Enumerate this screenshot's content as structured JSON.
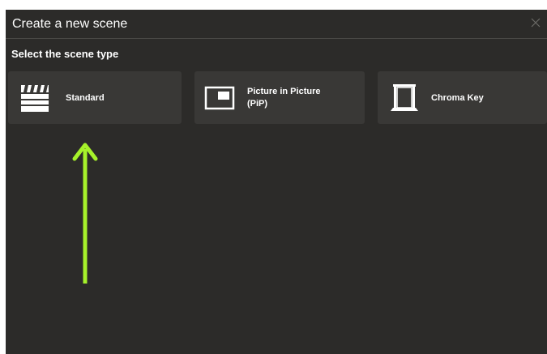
{
  "dialog": {
    "title": "Create a new scene",
    "close_icon": "close-icon",
    "subtitle": "Select the scene type"
  },
  "scene_types": [
    {
      "id": "standard",
      "label": "Standard",
      "icon": "clapperboard-icon"
    },
    {
      "id": "pip",
      "label_line1": "Picture in Picture",
      "label_line2": "(PiP)",
      "icon": "picture-in-picture-icon"
    },
    {
      "id": "chroma",
      "label": "Chroma Key",
      "icon": "chroma-key-icon"
    }
  ],
  "annotation": {
    "arrow_color": "#a6f22a",
    "arrow_icon": "up-arrow-annotation"
  },
  "colors": {
    "dialog_bg": "#2c2b29",
    "card_bg": "#393836",
    "text": "#ffffff"
  }
}
